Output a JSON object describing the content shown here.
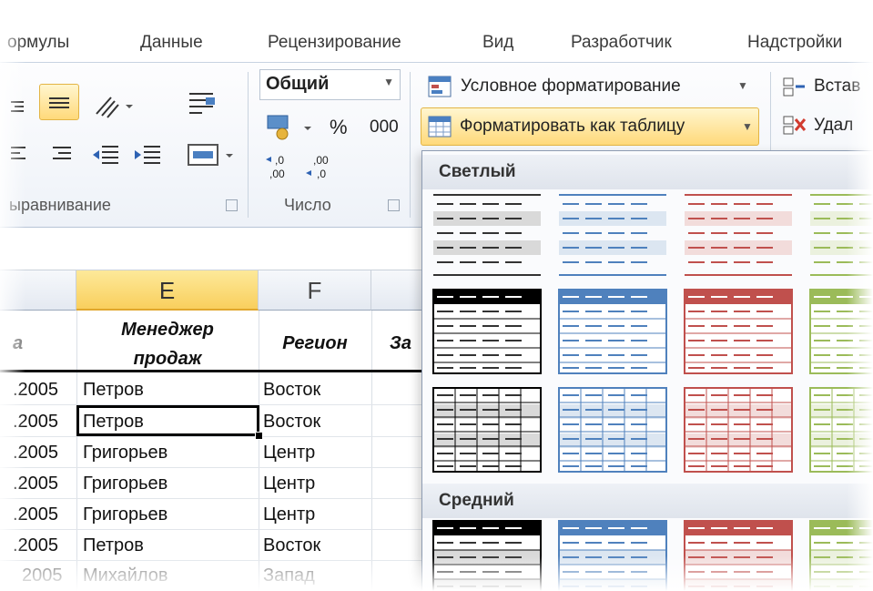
{
  "tabs": [
    "ормулы",
    "Данные",
    "Рецензирование",
    "Вид",
    "Разработчик",
    "Надстройки"
  ],
  "groups": {
    "alignment_label": "ыравнивание",
    "number_label": "Число"
  },
  "number_format": {
    "value": "Общий"
  },
  "number_buttons": {
    "percent": "%",
    "thousands": "000",
    "inc_decimal": ",0 ,00",
    "dec_decimal": ",00 ,0"
  },
  "styles": {
    "conditional": "Условное форматирование",
    "format_as_table": "Форматировать как таблицу"
  },
  "cells_group": {
    "insert": "Встав",
    "delete": "Удал"
  },
  "gallery": {
    "light_label": "Светлый",
    "medium_label": "Средний",
    "colors": [
      "#000000",
      "#4f81bd",
      "#c0504d",
      "#9bbb59"
    ]
  },
  "columns": {
    "E": "E",
    "F": "F"
  },
  "header_row": {
    "d": "а",
    "e_line1": "Менеджер",
    "e_line2": "продаж",
    "f": "Регион",
    "g": "За"
  },
  "rows": [
    {
      "d": ".2005",
      "e": "Петров",
      "f": "Восток"
    },
    {
      "d": ".2005",
      "e": "Петров",
      "f": "Восток"
    },
    {
      "d": ".2005",
      "e": "Григорьев",
      "f": "Центр"
    },
    {
      "d": ".2005",
      "e": "Григорьев",
      "f": "Центр"
    },
    {
      "d": ".2005",
      "e": "Григорьев",
      "f": "Центр"
    },
    {
      "d": ".2005",
      "e": "Петров",
      "f": "Восток"
    },
    {
      "d": "2005",
      "e": "Михайлов",
      "f": "Запад"
    }
  ]
}
